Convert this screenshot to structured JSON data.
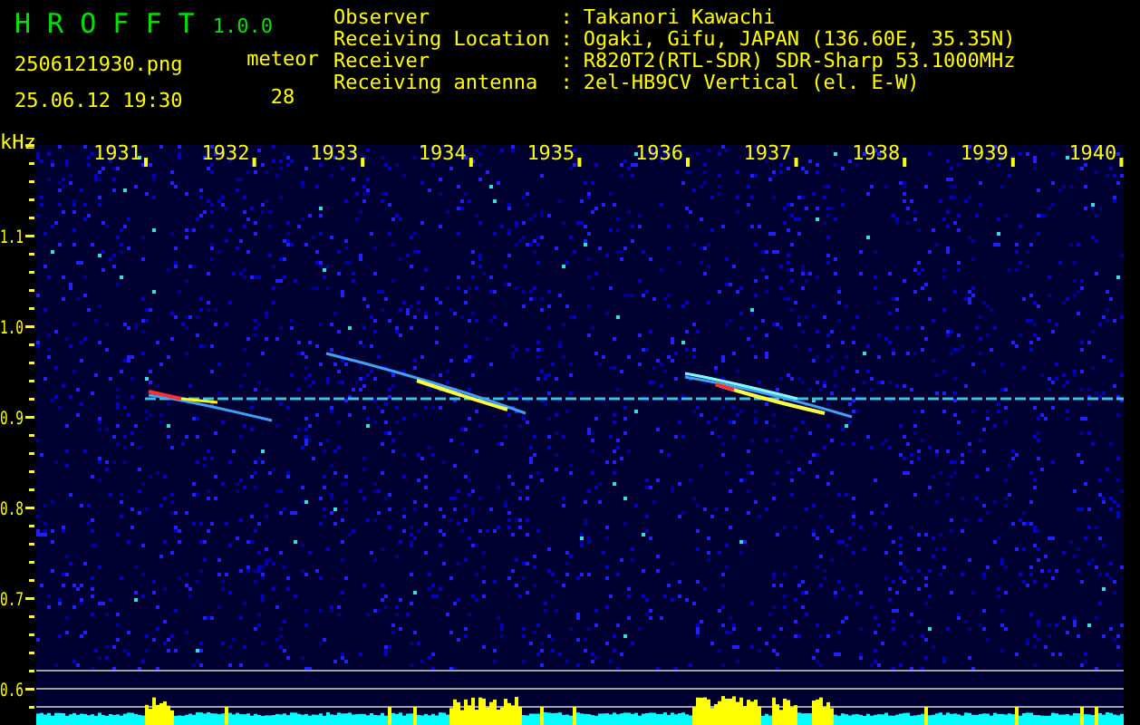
{
  "app": {
    "name": "H R O F F T",
    "version": "1.0.0"
  },
  "file": {
    "name": "2506121930.png",
    "datetime": "25.06.12 19:30"
  },
  "meteor": {
    "label": "meteor",
    "count": "28"
  },
  "info": [
    {
      "label": "Observer",
      "separator": ":",
      "value": "Takanori Kawachi"
    },
    {
      "label": "Receiving Location",
      "separator": ":",
      "value": "Ogaki, Gifu, JAPAN (136.60E, 35.35N)"
    },
    {
      "label": "Receiver",
      "separator": ":",
      "value": "R820T2(RTL-SDR) SDR-Sharp 53.1000MHz"
    },
    {
      "label": "Receiving antenna",
      "separator": ":",
      "value": "2el-HB9CV Vertical (el. E-W)"
    }
  ],
  "plot": {
    "y_unit": "kHz",
    "x_ticks": [
      "1931",
      "1932",
      "1933",
      "1934",
      "1935",
      "1936",
      "1937",
      "1938",
      "1939",
      "1940"
    ],
    "y_ticks": [
      "1.1",
      "1.0",
      "0.9",
      "0.8",
      "0.7",
      "0.6"
    ]
  }
}
